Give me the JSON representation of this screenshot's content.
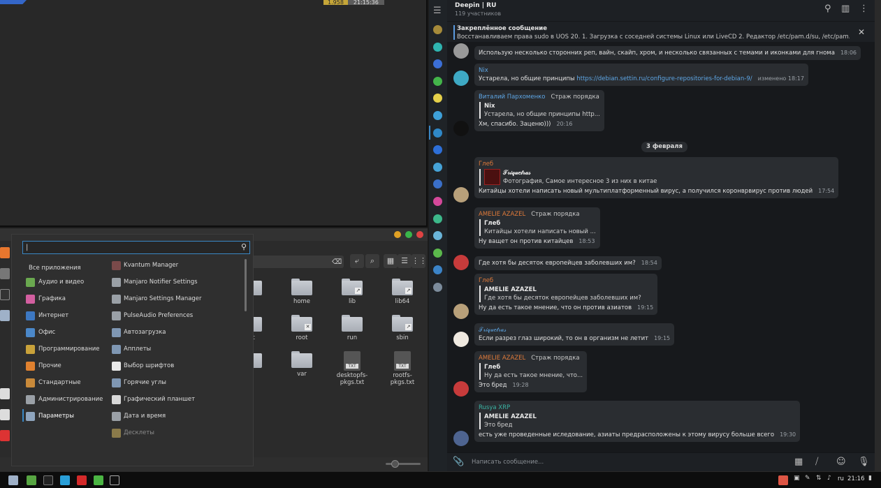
{
  "terminal": {
    "status_left": "1.958",
    "status_time": "21:15:36"
  },
  "menu": {
    "search_value": "|",
    "categories": [
      {
        "label": "Все приложения",
        "icon": "none",
        "color": "#2f2f2f"
      },
      {
        "label": "Аудио и видео",
        "icon": "audio-video-icon",
        "color": "#6aa84f"
      },
      {
        "label": "Графика",
        "icon": "graphics-icon",
        "color": "#d35fa0"
      },
      {
        "label": "Интернет",
        "icon": "internet-icon",
        "color": "#3d78c2"
      },
      {
        "label": "Офис",
        "icon": "office-icon",
        "color": "#4b88c9"
      },
      {
        "label": "Программирование",
        "icon": "programming-icon",
        "color": "#c9a23a"
      },
      {
        "label": "Прочие",
        "icon": "other-icon",
        "color": "#e0812f"
      },
      {
        "label": "Стандартные",
        "icon": "standard-icon",
        "color": "#c98a3a"
      },
      {
        "label": "Администрирование",
        "icon": "admin-icon",
        "color": "#9aa0a6"
      },
      {
        "label": "Параметры",
        "icon": "settings-icon",
        "color": "#8ea4bd"
      }
    ],
    "apps": [
      {
        "label": "Kvantum Manager",
        "icon": "kvantum-icon",
        "color": "#7a4a4a",
        "dim": false
      },
      {
        "label": "Manjaro Notifier Settings",
        "icon": "manjaro-notifier-icon",
        "color": "#9aa0a6",
        "dim": false
      },
      {
        "label": "Manjaro Settings Manager",
        "icon": "manjaro-settings-icon",
        "color": "#9aa0a6",
        "dim": false
      },
      {
        "label": "PulseAudio Preferences",
        "icon": "pulseaudio-icon",
        "color": "#9aa0a6",
        "dim": false
      },
      {
        "label": "Автозагрузка",
        "icon": "autostart-icon",
        "color": "#7f97b3",
        "dim": false
      },
      {
        "label": "Апплеты",
        "icon": "applets-icon",
        "color": "#7f97b3",
        "dim": false
      },
      {
        "label": "Выбор шрифтов",
        "icon": "font-icon",
        "color": "#e8e8e8",
        "dim": false
      },
      {
        "label": "Горячие углы",
        "icon": "hot-corners-icon",
        "color": "#7f97b3",
        "dim": false
      },
      {
        "label": "Графический планшет",
        "icon": "tablet-icon",
        "color": "#d8d8d8",
        "dim": false
      },
      {
        "label": "Дата и время",
        "icon": "clock-icon",
        "color": "#9aa0a6",
        "dim": false
      },
      {
        "label": "Десклеты",
        "icon": "desklets-icon",
        "color": "#8a7a4a",
        "dim": true
      }
    ]
  },
  "filemanager": {
    "files": [
      {
        "label": "c",
        "kind": "folder",
        "emblem": ""
      },
      {
        "label": "home",
        "kind": "folder",
        "emblem": ""
      },
      {
        "label": "lib",
        "kind": "folder",
        "emblem": "↗"
      },
      {
        "label": "lib64",
        "kind": "folder",
        "emblem": "↗"
      },
      {
        "label": "oc",
        "kind": "folder",
        "emblem": ""
      },
      {
        "label": "root",
        "kind": "folder",
        "emblem": "✕"
      },
      {
        "label": "run",
        "kind": "folder",
        "emblem": ""
      },
      {
        "label": "sbin",
        "kind": "folder",
        "emblem": "↗"
      },
      {
        "label": "ir",
        "kind": "folder",
        "emblem": ""
      },
      {
        "label": "var",
        "kind": "folder",
        "emblem": ""
      },
      {
        "label": "desktopfs-pkgs.txt",
        "kind": "txt",
        "emblem": "TXT"
      },
      {
        "label": "rootfs-pkgs.txt",
        "kind": "txt",
        "emblem": "TXT"
      }
    ]
  },
  "telegram": {
    "chat_title": "Deepin | RU",
    "chat_subtitle": "119 участников",
    "pinned_title": "Закреплённое сообщение",
    "pinned_text": "Восстанавливаем права  sudo в UOS 20. 1. Загрузка с соседней системы  Linux или  LiveCD 2. Редактор  /etc/pam.d/su, /etc/pam.d/s...",
    "date_separator": "3 февраля",
    "input_placeholder": "Написать сообщение...",
    "messages": [
      {
        "author": "",
        "role": "",
        "text": "Использую несколько сторонних реп, вайн, скайп, хром, и несколько связанных с темами и иконками для гнома",
        "time": "18:06"
      },
      {
        "author": "Nix",
        "role": "",
        "text": "Устарела, но общие принципы ",
        "link": "https://debian.settin.ru/configure-repositories-for-debian-9/",
        "time": "изменено 18:17"
      },
      {
        "author": "Виталий Пархоменко",
        "role": "Страж порядка",
        "quote_author": "Nix",
        "quote_text": "Устарела, но общие принципы http...",
        "text": "Хм, спасибо. Заценю)))",
        "time": "20:16"
      },
      {
        "author": "Глеб",
        "role": "",
        "quote_author": "𝒯𝓇𝒾𝓆𝓊𝑒𝓉𝓇𝒶𝓈",
        "quote_text": "Фотография, Самое интересное 3 из них в китае",
        "text": "Китайцы хотели написать новый мультиплатформенный вирус, а получился коронврвирус против людей",
        "time": "17:54"
      },
      {
        "author": "AMELIE AZAZEL",
        "role": "Страж порядка",
        "quote_author": "Глеб",
        "quote_text": "Китайцы хотели написать новый ...",
        "text": "Ну ващет он против китайцев",
        "time": "18:53"
      },
      {
        "author": "",
        "role": "",
        "text": "Где хотя бы десяток европейцев заболевших им?",
        "time": "18:54"
      },
      {
        "author": "Глеб",
        "role": "",
        "quote_author": "AMELIE AZAZEL",
        "quote_text": "Где хотя бы десяток европейцев заболевших им?",
        "text": "Ну да есть такое мнение, что он против азиатов",
        "time": "19:15"
      },
      {
        "author": "𝒯𝓇𝒾𝓆𝓊𝑒𝓉𝓇𝒶𝓈",
        "role": "",
        "text": "Если разрез глаз широкий, то он в организм не летит",
        "time": "19:15"
      },
      {
        "author": "AMELIE AZAZEL",
        "role": "Страж порядка",
        "quote_author": "Глеб",
        "quote_text": "Ну да есть такое мнение, что...",
        "text": "Это бред",
        "time": "19:28"
      },
      {
        "author": "Rusya XRP",
        "role": "",
        "quote_author": "AMELIE AZAZEL",
        "quote_text": "Это бред",
        "text": "есть уже проведенные иследование, азиаты предрасположены к этому вирусу больше всего",
        "time": "19:30"
      }
    ]
  },
  "taskbar": {
    "lang": "ru",
    "clock": "21:16"
  }
}
